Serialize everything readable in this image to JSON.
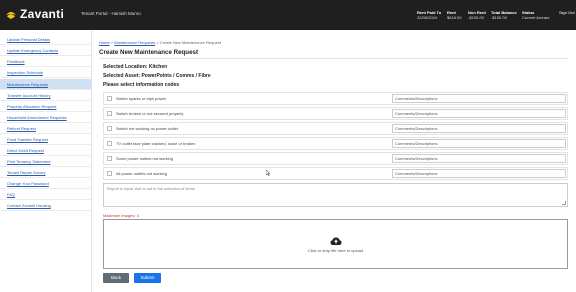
{
  "header": {
    "brand": "Zavanti",
    "portal_title": "Tenant Portal - Hamish Munro",
    "stats": [
      {
        "label": "Rent Paid To",
        "value": "22/06/2024"
      },
      {
        "label": "Rent",
        "value": "$618.00"
      },
      {
        "label": "Non Rent",
        "value": "-$150.00"
      },
      {
        "label": "Total Balance",
        "value": "-$150.00"
      },
      {
        "label": "Status",
        "value": "Current Arrears"
      }
    ],
    "sign_out": "Sign Out"
  },
  "sidebar": {
    "items": [
      {
        "label": "Update Personal Details"
      },
      {
        "label": "Update Emergency Contacts"
      },
      {
        "label": "Feedback"
      },
      {
        "label": "Inspection Schedule"
      },
      {
        "label": "Maintenance Requests"
      },
      {
        "label": "Transfer Account History"
      },
      {
        "label": "Property Allocation Request"
      },
      {
        "label": "Household Amendment Requests"
      },
      {
        "label": "Refund Request"
      },
      {
        "label": "Fund Transfer Request"
      },
      {
        "label": "Direct Debit Request"
      },
      {
        "label": "Print Tenancy Statement"
      },
      {
        "label": "Tenant Repair Survey"
      },
      {
        "label": "Change Your Password"
      },
      {
        "label": "FAQ"
      },
      {
        "label": "Contact Zavanti Housing"
      }
    ]
  },
  "breadcrumb": {
    "home": "Home",
    "sep1": ">",
    "parent": "Maintenance Requests",
    "sep2": ">",
    "current": "Create New Maintenance Request"
  },
  "page_title": "Create New Maintenance Request",
  "selected_location": "Selected Location: Kitchen",
  "selected_asset": "Selected Asset: PowerPoints / Comms / Fibre",
  "select_codes": "Please select information codes",
  "codes": [
    {
      "label": "Switch sparks or trips power",
      "comment_placeholder": "Comments/Descriptions"
    },
    {
      "label": "Switch broken or not secured properly",
      "comment_placeholder": "Comments/Descriptions"
    },
    {
      "label": "Switch not working on power outlet",
      "comment_placeholder": "Comments/Descriptions"
    },
    {
      "label": "TV outlet face plate cracked, loose or broken",
      "comment_placeholder": "Comments/Descriptions"
    },
    {
      "label": "Some power outlets not working",
      "comment_placeholder": "Comments/Descriptions"
    },
    {
      "label": "All power outlets not working",
      "comment_placeholder": "Comments/Descriptions"
    }
  ],
  "other_repair_placeholder": "Report a repair that is not in the selection of items",
  "max_images": "Maximum images: 3",
  "upload_text": "Click or drop file here to upload",
  "buttons": {
    "back": "Back",
    "submit": "Submit"
  },
  "colors": {
    "topbar": "#1f1f1f",
    "accent": "#1a73e8",
    "sidebar_active": "#cfe0f3",
    "logo": "#f5c518"
  }
}
